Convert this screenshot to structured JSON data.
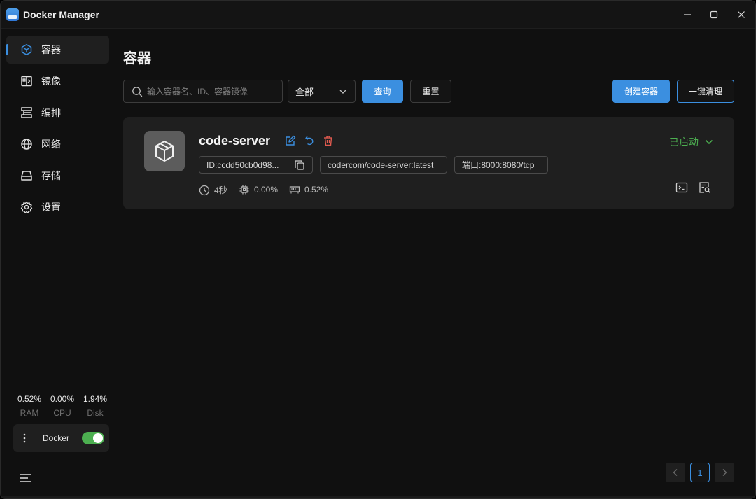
{
  "app": {
    "title": "Docker Manager"
  },
  "sidebar": {
    "items": [
      {
        "label": "容器",
        "icon": "container-icon",
        "active": true
      },
      {
        "label": "镜像",
        "icon": "image-icon",
        "active": false
      },
      {
        "label": "编排",
        "icon": "compose-icon",
        "active": false
      },
      {
        "label": "网络",
        "icon": "globe-icon",
        "active": false
      },
      {
        "label": "存储",
        "icon": "storage-icon",
        "active": false
      },
      {
        "label": "设置",
        "icon": "gear-icon",
        "active": false
      }
    ],
    "stats": [
      {
        "value": "0.52%",
        "label": "RAM"
      },
      {
        "value": "0.00%",
        "label": "CPU"
      },
      {
        "value": "1.94%",
        "label": "Disk"
      }
    ],
    "docker": {
      "label": "Docker",
      "enabled": true
    }
  },
  "main": {
    "title": "容器",
    "search": {
      "placeholder": "输入容器名、ID、容器镜像",
      "value": ""
    },
    "filter": {
      "selected": "全部"
    },
    "buttons": {
      "query": "查询",
      "reset": "重置",
      "create": "创建容器",
      "cleanup": "一键清理"
    },
    "containers": [
      {
        "name": "code-server",
        "status": "已启动",
        "id": "ID:ccdd50cb0d98...",
        "image": "codercom/code-server:latest",
        "port": "端口:8000:8080/tcp",
        "uptime": "4秒",
        "cpu": "0.00%",
        "memory": "0.52%"
      }
    ],
    "pagination": {
      "current": "1"
    }
  },
  "colors": {
    "accent": "#3b8fe0",
    "success": "#4caf50",
    "danger": "#e05a4f",
    "background": "#101010",
    "card": "#1f1f1f"
  }
}
